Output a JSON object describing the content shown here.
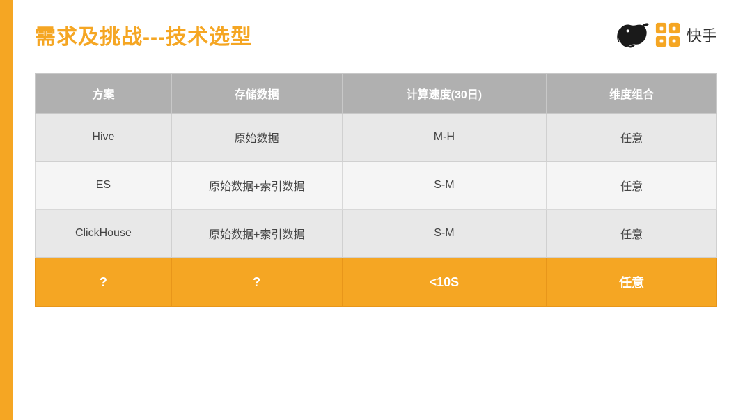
{
  "slide": {
    "title": "需求及挑战---技术选型",
    "logo_text": "快手"
  },
  "table": {
    "headers": [
      "方案",
      "存储数据",
      "计算速度(30日)",
      "维度组合"
    ],
    "rows": [
      {
        "solution": "Hive",
        "storage": "原始数据",
        "speed": "M-H",
        "dim": "任意"
      },
      {
        "solution": "ES",
        "storage": "原始数据+索引数据",
        "speed": "S-M",
        "dim": "任意"
      },
      {
        "solution": "ClickHouse",
        "storage": "原始数据+索引数据",
        "speed": "S-M",
        "dim": "任意"
      },
      {
        "solution": "?",
        "storage": "?",
        "speed": "<10S",
        "dim": "任意"
      }
    ]
  }
}
